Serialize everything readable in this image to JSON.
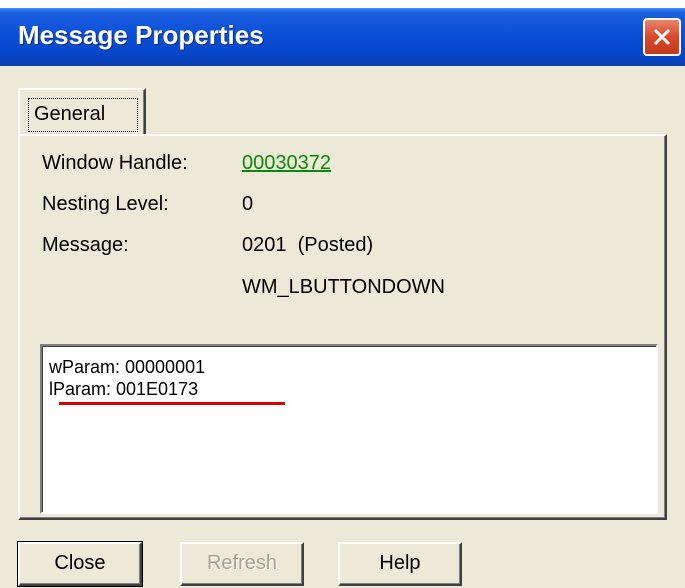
{
  "window": {
    "title": "Message Properties"
  },
  "tabs": [
    {
      "label": "General"
    }
  ],
  "fields": {
    "window_handle": {
      "label": "Window Handle:",
      "value": "00030372"
    },
    "nesting_level": {
      "label": "Nesting Level:",
      "value": "0"
    },
    "message": {
      "label": "Message:",
      "value": "0201  (Posted)",
      "name": "WM_LBUTTONDOWN"
    }
  },
  "params": {
    "wparam": "wParam: 00000001",
    "lparam": "lParam: 001E0173"
  },
  "buttons": {
    "close": "Close",
    "refresh": "Refresh",
    "help": "Help"
  },
  "colors": {
    "titlebar": "#0a4fd6",
    "link": "#0a8a0a",
    "annotation_underline": "#e00000",
    "dialog_bg": "#ece9d8"
  },
  "icons": {
    "close": "close-x-icon"
  }
}
